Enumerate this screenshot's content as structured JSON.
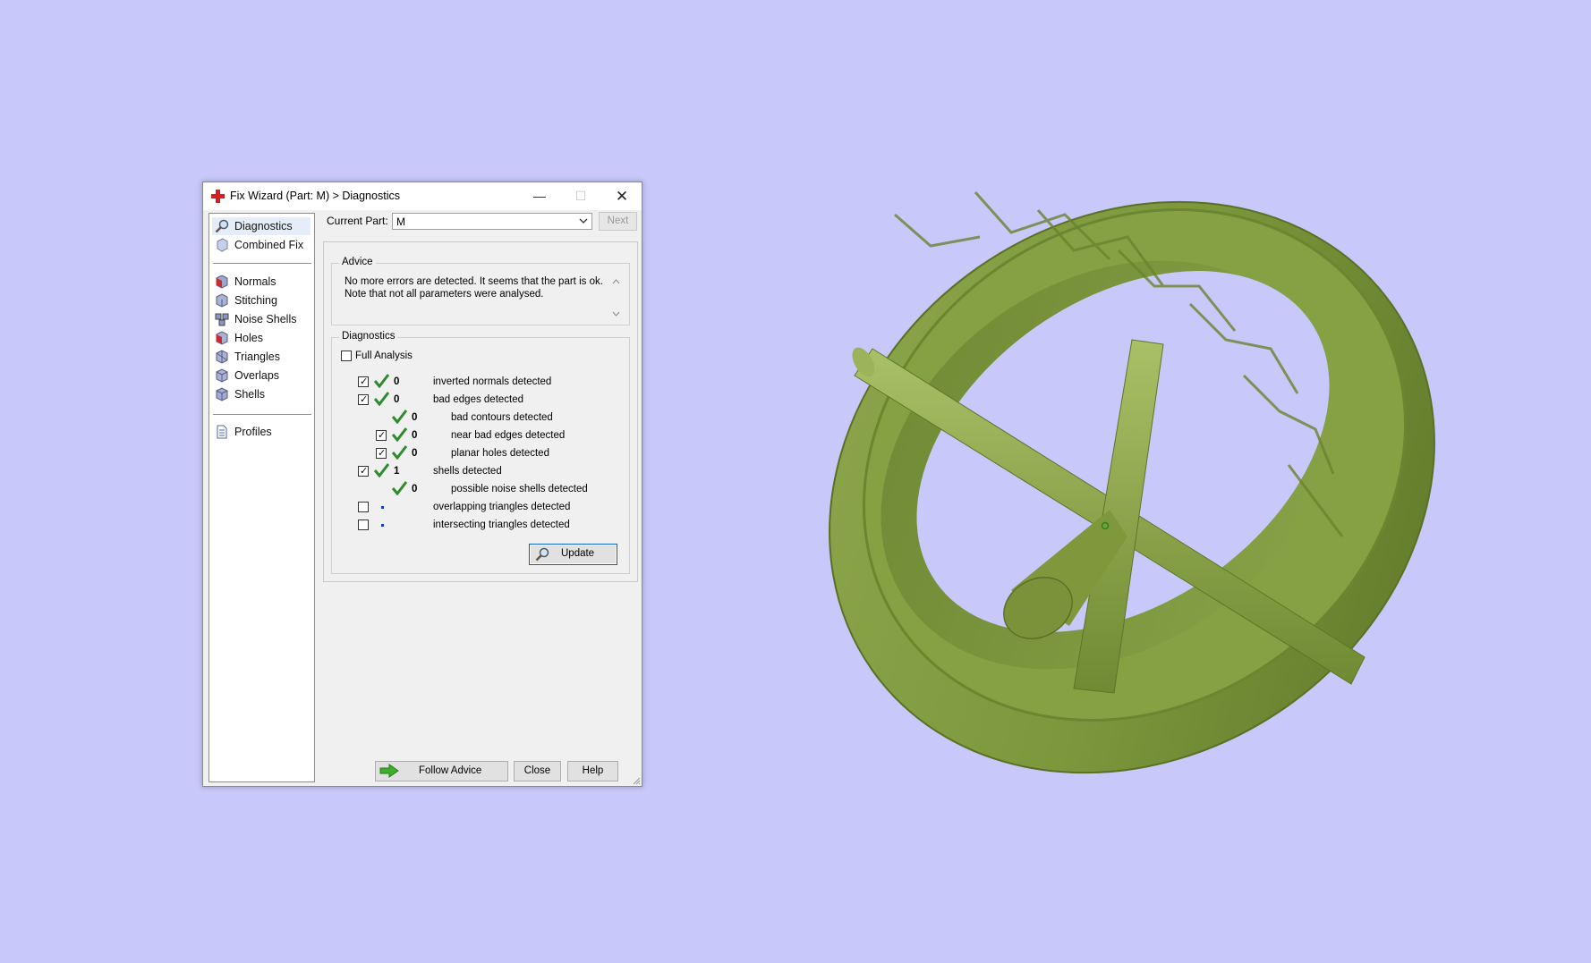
{
  "window": {
    "title": "Fix Wizard (Part: M) > Diagnostics",
    "minimize_glyph": "—",
    "maximize_glyph": "☐",
    "close_glyph": "✕"
  },
  "sidebar": {
    "items": [
      {
        "label": "Diagnostics",
        "icon": "magnifier-icon",
        "selected": true
      },
      {
        "label": "Combined Fix",
        "icon": "combined-fix-icon"
      },
      {
        "label": "Normals",
        "icon": "normals-cube-icon"
      },
      {
        "label": "Stitching",
        "icon": "stitching-cube-icon"
      },
      {
        "label": "Noise Shells",
        "icon": "noise-shells-icon"
      },
      {
        "label": "Holes",
        "icon": "holes-cube-icon"
      },
      {
        "label": "Triangles",
        "icon": "triangles-cube-icon"
      },
      {
        "label": "Overlaps",
        "icon": "overlaps-cube-icon"
      },
      {
        "label": "Shells",
        "icon": "shells-cube-icon"
      },
      {
        "label": "Profiles",
        "icon": "profiles-document-icon"
      }
    ]
  },
  "header": {
    "current_part_label": "Current Part:",
    "current_part_value": "M",
    "next_label": "Next"
  },
  "advice": {
    "title": "Advice",
    "line1": "No more errors are detected. It seems that the part is ok.",
    "line2": "Note that not all parameters were analysed."
  },
  "diagnostics": {
    "title": "Diagnostics",
    "full_analysis_label": "Full Analysis",
    "full_analysis_checked": false,
    "rows": [
      {
        "checkbox": true,
        "checked": true,
        "status": "ok",
        "count": "0",
        "label": "inverted normals detected"
      },
      {
        "checkbox": true,
        "checked": true,
        "status": "ok",
        "count": "0",
        "label": "bad edges detected"
      },
      {
        "checkbox": false,
        "checked": false,
        "status": "ok",
        "count": "0",
        "label": "bad contours detected"
      },
      {
        "checkbox": true,
        "checked": true,
        "status": "ok",
        "count": "0",
        "label": "near bad edges detected"
      },
      {
        "checkbox": true,
        "checked": true,
        "status": "ok",
        "count": "0",
        "label": "planar holes detected"
      },
      {
        "checkbox": true,
        "checked": true,
        "status": "ok",
        "count": "1",
        "label": "shells detected"
      },
      {
        "checkbox": false,
        "checked": false,
        "status": "ok",
        "count": "0",
        "label": "possible noise shells detected"
      },
      {
        "checkbox": true,
        "checked": false,
        "status": "pending",
        "count": "",
        "label": "overlapping triangles detected"
      },
      {
        "checkbox": true,
        "checked": false,
        "status": "pending",
        "count": "",
        "label": "intersecting triangles detected"
      }
    ],
    "update_label": "Update"
  },
  "footer": {
    "follow_advice_label": "Follow Advice",
    "close_label": "Close",
    "help_label": "Help"
  },
  "colors": {
    "background": "#c8c8fa",
    "model": "#7f9a3f",
    "ok_check": "#2e8b2e",
    "dialog": "#f0f0f0"
  }
}
